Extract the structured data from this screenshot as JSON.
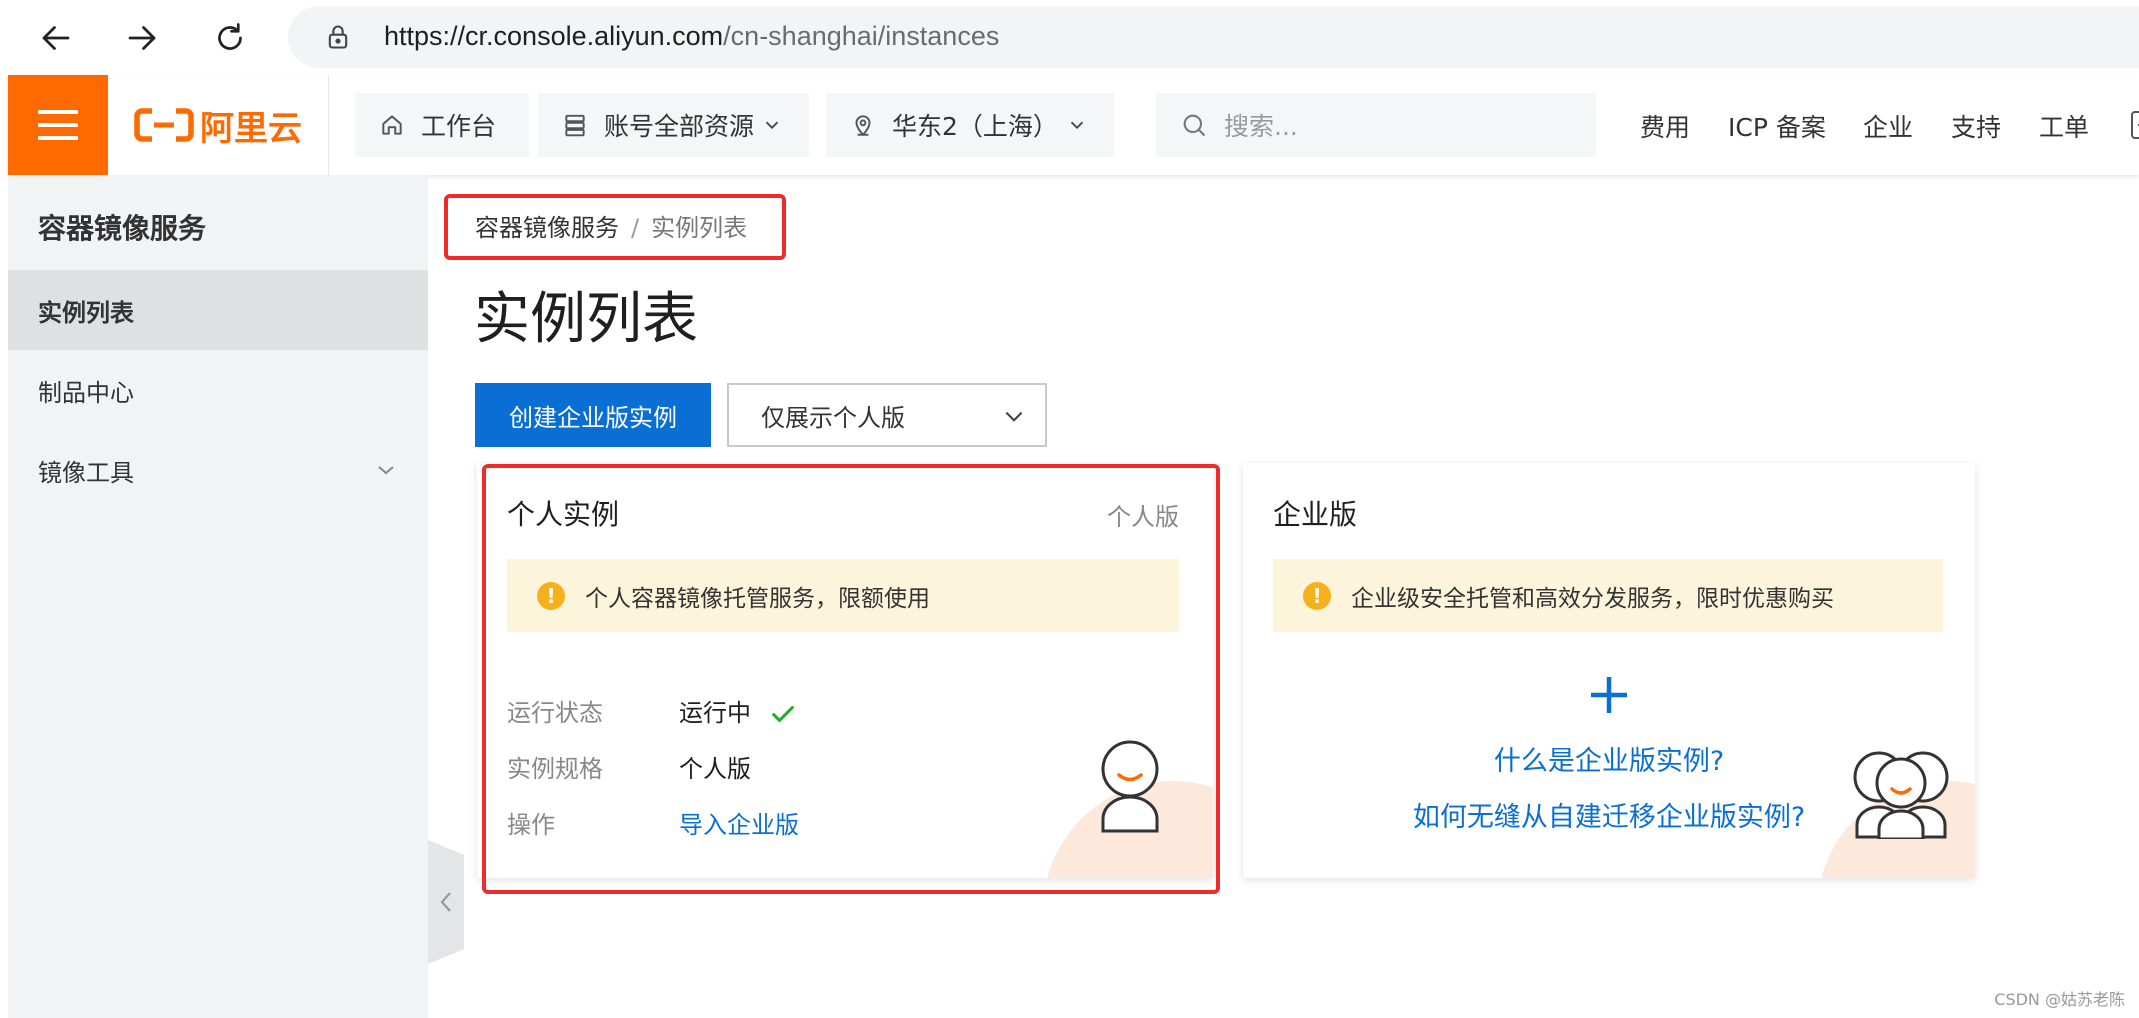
{
  "browser": {
    "url_domain": "https://cr.console.aliyun.com",
    "url_path": "/cn-shanghai/instances"
  },
  "topbar": {
    "logo_text": "阿里云",
    "workbench": "工作台",
    "resources": "账号全部资源",
    "region": "华东2（上海）",
    "search_placeholder": "搜索...",
    "links": [
      "费用",
      "ICP 备案",
      "企业",
      "支持",
      "工单"
    ]
  },
  "sidebar": {
    "title": "容器镜像服务",
    "items": [
      {
        "label": "实例列表",
        "active": true
      },
      {
        "label": "制品中心",
        "active": false
      },
      {
        "label": "镜像工具",
        "active": false,
        "expandable": true
      }
    ]
  },
  "breadcrumb": {
    "root": "容器镜像服务",
    "separator": "/",
    "current": "实例列表"
  },
  "page": {
    "title": "实例列表",
    "create_button": "创建企业版实例",
    "filter_select": "仅展示个人版"
  },
  "personal_card": {
    "title": "个人实例",
    "tag": "个人版",
    "notice": "个人容器镜像托管服务，限额使用",
    "rows": [
      {
        "label": "运行状态",
        "value": "运行中"
      },
      {
        "label": "实例规格",
        "value": "个人版"
      },
      {
        "label": "操作",
        "value": "导入企业版"
      }
    ]
  },
  "enterprise_card": {
    "title": "企业版",
    "notice": "企业级安全托管和高效分发服务，限时优惠购买",
    "link1": "什么是企业版实例?",
    "link2": "如何无缝从自建迁移企业版实例?"
  },
  "watermark": "CSDN @姑苏老陈",
  "colors": {
    "brand_orange": "#ff6a00",
    "primary_blue": "#0a6fd4",
    "highlight_red": "#ee2a2a",
    "notice_bg": "#fdf4dc"
  }
}
